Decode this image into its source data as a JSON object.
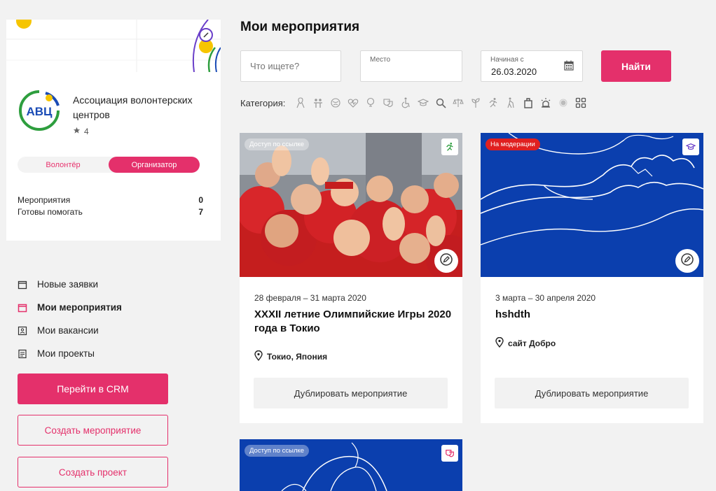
{
  "organization": {
    "name": "Ассоциация волонтерских центров",
    "rating": "4",
    "logo_text": "АВЦ"
  },
  "role_switch": {
    "volunteer": "Волонтёр",
    "organizer": "Организатор",
    "active": "organizer"
  },
  "stats": [
    {
      "label": "Мероприятия",
      "value": "0"
    },
    {
      "label": "Готовы помогать",
      "value": "7"
    }
  ],
  "nav": [
    {
      "label": "Новые заявки",
      "icon": "calendar-icon",
      "active": false
    },
    {
      "label": "Мои мероприятия",
      "icon": "calendar-icon",
      "active": true
    },
    {
      "label": "Мои вакансии",
      "icon": "vacancy-icon",
      "active": false
    },
    {
      "label": "Мои проекты",
      "icon": "document-icon",
      "active": false
    }
  ],
  "buttons": {
    "crm": "Перейти в CRM",
    "create_event": "Создать мероприятие",
    "create_project": "Создать проект",
    "find": "Найти",
    "duplicate": "Дублировать мероприятие"
  },
  "page_title": "Мои мероприятия",
  "search": {
    "what_placeholder": "Что ищете?",
    "place_label": "Место",
    "place_value": "",
    "date_label": "Начиная с",
    "date_value": "26.03.2020"
  },
  "category_label": "Категория:",
  "category_icons": [
    "ribbon-icon",
    "people-icon",
    "globe-icon",
    "heart-icon",
    "bulb-icon",
    "masks-icon",
    "wheelchair-icon",
    "graduation-cap-icon",
    "search-icon",
    "justice-icon",
    "plant-icon",
    "runner-icon",
    "elderly-icon",
    "bag-icon",
    "siren-icon",
    "virus-icon",
    "grid-icon"
  ],
  "events": [
    {
      "badge": "Доступ по ссылке",
      "category_icon": "runner-icon",
      "date": "28 февраля – 31 марта 2020",
      "title": "XXXII летние Олимпийские Игры 2020 года в Токио",
      "location": "Токио, Япония"
    },
    {
      "badge": "На модерации",
      "category_icon": "graduation-cap-icon",
      "date": "3 марта – 30 апреля 2020",
      "title": "hshdth",
      "location": "сайт Добро"
    },
    {
      "badge": "Доступ по ссылке",
      "category_icon": "masks-icon"
    }
  ],
  "colors": {
    "accent": "#e4306b",
    "card_blue": "#0b3fae",
    "moderation_red": "#e02020",
    "logo_green": "#2e9e3e",
    "logo_blue": "#1a4bb5",
    "logo_yellow": "#f6c500"
  }
}
